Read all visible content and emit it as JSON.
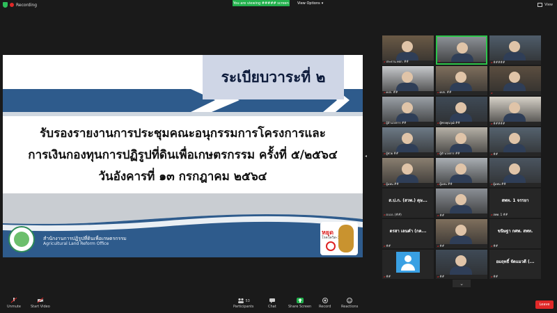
{
  "topbar": {
    "recording_label": "Recording",
    "viewing_banner": "You are viewing ##### screen",
    "view_options_label": "View Options",
    "view_label": "View"
  },
  "slide": {
    "agenda_title": "ระเบียบวาระที่ ๒",
    "line1": "รับรองรายงานการประชุมคณะอนุกรรมการโครงการและ",
    "line2": "การเงินกองทุนการปฏิรูปที่ดินเพื่อเกษตรกรรม ครั้งที่ ๕/๒๕๖๔",
    "line3": "วันอังคารที่ ๑๓ กรกฎาคม ๒๕๖๔",
    "org_thai": "สำนักงานการปฏิรูปที่ดินเพื่อเกษตรกรรม",
    "org_en": "Agricultural Land Reform Office",
    "stop_sign_text": "หยุด",
    "stop_sign_sub": "โรคโควิด-19",
    "colors": {
      "band": "#2e5b8c",
      "title_box": "#cfd6e6"
    }
  },
  "participants": [
    {
      "name": "ประธาน คปก. ##",
      "video": true,
      "active": false
    },
    {
      "name": "",
      "video": true,
      "active": true
    },
    {
      "name": "#####",
      "video": true,
      "active": false
    },
    {
      "name": "คปก. ##",
      "video": true,
      "active": false
    },
    {
      "name": "คปก. ##",
      "video": true,
      "active": false
    },
    {
      "name": "",
      "video": true,
      "active": false
    },
    {
      "name": "ผู้อำนวยการ ##",
      "video": true,
      "active": false
    },
    {
      "name": "ผู้ทรงคุณวุฒิ ##",
      "video": true,
      "active": false
    },
    {
      "name": "#####",
      "video": true,
      "active": false
    },
    {
      "name": "ผู้ช่วย ##",
      "video": true,
      "active": false
    },
    {
      "name": "ผู้อำนวยการ ##",
      "video": true,
      "active": false
    },
    {
      "name": "##",
      "video": true,
      "active": false
    },
    {
      "name": "ผู้แทน ##",
      "video": true,
      "active": false
    },
    {
      "name": "ผู้แทน ##",
      "video": true,
      "active": false
    },
    {
      "name": "ผู้แทน ##",
      "video": true,
      "active": false
    },
    {
      "name": "ส.ป.ก. (##)",
      "center": "ส.ป.ก. (สวพ.) ดุษ...",
      "video": false,
      "active": false
    },
    {
      "name": "##",
      "video": true,
      "active": false
    },
    {
      "name": "สพท. 1 ##",
      "center": "สพท. 1 จรรยา",
      "video": false,
      "active": false
    },
    {
      "name": "##",
      "center": "ดรสา เลนคำ (กค...",
      "video": false,
      "active": false
    },
    {
      "name": "##",
      "video": true,
      "active": false
    },
    {
      "name": "##",
      "center": "ขนิษฐา กศพ. สพท.",
      "video": false,
      "active": false
    },
    {
      "name": "##",
      "avatar": true,
      "video": false,
      "active": false
    },
    {
      "name": "##",
      "video": true,
      "active": false
    },
    {
      "name": "##",
      "center": "อมฤทธิ์ จัดแมวดี (...",
      "video": false,
      "active": false
    }
  ],
  "toolbar": {
    "unmute": "Unmute",
    "start_video": "Start Video",
    "participants": "Participants",
    "participants_count": "53",
    "chat": "Chat",
    "share_screen": "Share Screen",
    "record": "Record",
    "reactions": "Reactions",
    "leave": "Leave"
  }
}
